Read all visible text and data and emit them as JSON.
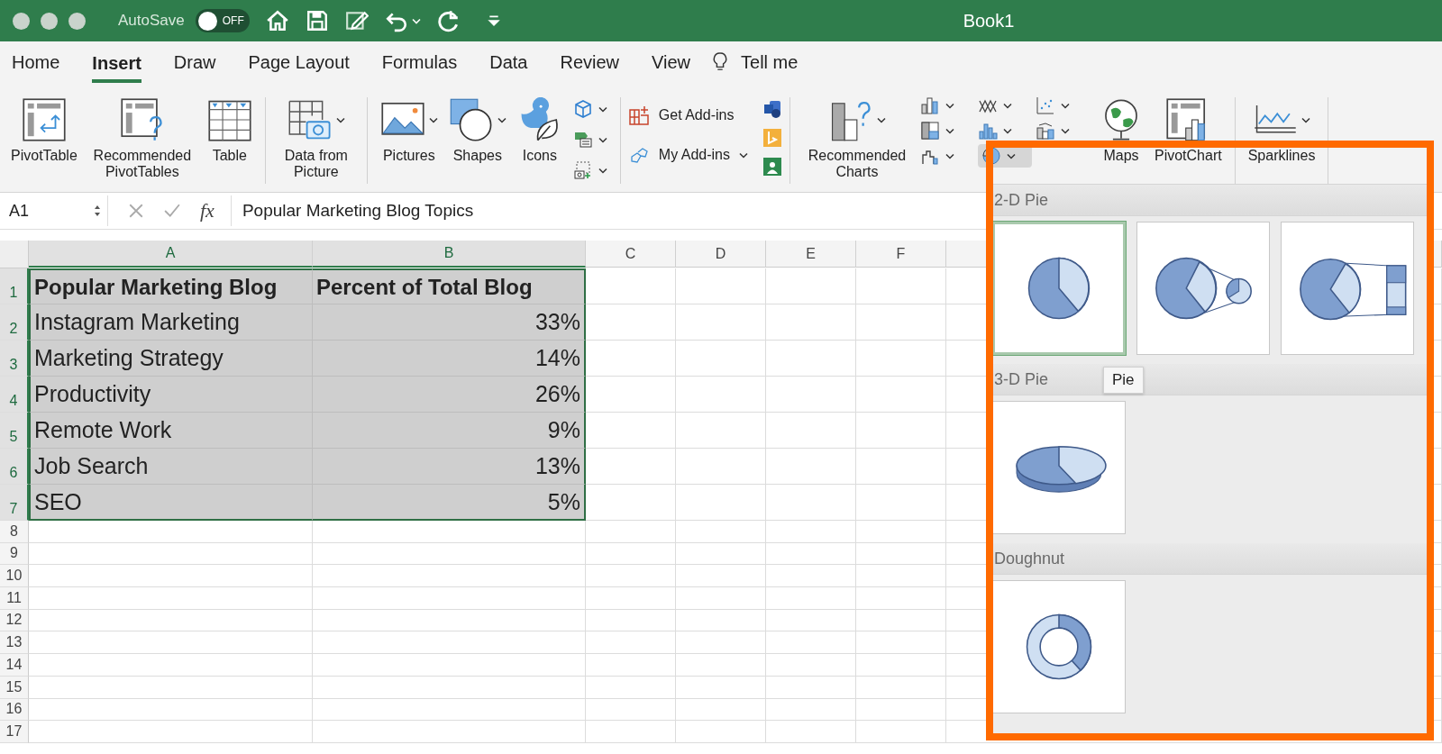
{
  "title_bar": {
    "autosave_label": "AutoSave",
    "autosave": {
      "on": false,
      "label": "OFF"
    },
    "title": "Book1"
  },
  "tabs": [
    {
      "label": "Home",
      "selected": false
    },
    {
      "label": "Insert",
      "selected": true
    },
    {
      "label": "Draw",
      "selected": false
    },
    {
      "label": "Page Layout",
      "selected": false
    },
    {
      "label": "Formulas",
      "selected": false
    },
    {
      "label": "Data",
      "selected": false
    },
    {
      "label": "Review",
      "selected": false
    },
    {
      "label": "View",
      "selected": false
    }
  ],
  "tell_me": "Tell me",
  "ribbon": {
    "pivot_table": "PivotTable",
    "recommended_pivot_tables": "Recommended PivotTables",
    "table": "Table",
    "data_from_picture": "Data from Picture",
    "pictures": "Pictures",
    "shapes": "Shapes",
    "icons": "Icons",
    "get_add_ins": "Get Add-ins",
    "my_add_ins": "My Add-ins",
    "recommended_charts": "Recommended Charts",
    "maps": "Maps",
    "pivot_chart": "PivotChart",
    "sparklines": "Sparklines"
  },
  "formula_bar": {
    "name_box": "A1",
    "fx": "fx",
    "formula": "Popular Marketing Blog Topics"
  },
  "sheet": {
    "columns": [
      {
        "label": "A",
        "selected": true
      },
      {
        "label": "B",
        "selected": true
      },
      {
        "label": "C",
        "selected": false
      },
      {
        "label": "D",
        "selected": false
      },
      {
        "label": "E",
        "selected": false
      },
      {
        "label": "F",
        "selected": false
      }
    ],
    "rows": [
      {
        "number": "1",
        "selected": true,
        "kind": "header",
        "cells": [
          "Popular Marketing Blog",
          "Percent of Total Blog"
        ]
      },
      {
        "number": "2",
        "selected": true,
        "kind": "data",
        "cells": [
          "Instagram Marketing",
          "33%"
        ]
      },
      {
        "number": "3",
        "selected": true,
        "kind": "data",
        "cells": [
          "Marketing Strategy",
          "14%"
        ]
      },
      {
        "number": "4",
        "selected": true,
        "kind": "data",
        "cells": [
          "Productivity",
          "26%"
        ]
      },
      {
        "number": "5",
        "selected": true,
        "kind": "data",
        "cells": [
          "Remote Work",
          "9%"
        ]
      },
      {
        "number": "6",
        "selected": true,
        "kind": "data",
        "cells": [
          "Job Search",
          "13%"
        ]
      },
      {
        "number": "7",
        "selected": true,
        "kind": "data",
        "cells": [
          "SEO",
          "5%"
        ]
      },
      {
        "number": "8",
        "selected": false,
        "kind": "empty"
      },
      {
        "number": "9",
        "selected": false,
        "kind": "empty"
      },
      {
        "number": "10",
        "selected": false,
        "kind": "empty"
      },
      {
        "number": "11",
        "selected": false,
        "kind": "empty"
      },
      {
        "number": "12",
        "selected": false,
        "kind": "empty"
      },
      {
        "number": "13",
        "selected": false,
        "kind": "empty"
      },
      {
        "number": "14",
        "selected": false,
        "kind": "empty"
      },
      {
        "number": "15",
        "selected": false,
        "kind": "empty"
      },
      {
        "number": "16",
        "selected": false,
        "kind": "empty"
      },
      {
        "number": "17",
        "selected": false,
        "kind": "empty"
      }
    ]
  },
  "chart_gallery": {
    "sections": [
      {
        "title": "2-D Pie",
        "thumbnails": [
          {
            "kind": "pie",
            "selected": true
          },
          {
            "kind": "pie-of-pie",
            "selected": false
          },
          {
            "kind": "bar-of-pie",
            "selected": false
          }
        ]
      },
      {
        "title": "3-D Pie",
        "thumbnails": [
          {
            "kind": "pie-3d",
            "selected": false
          }
        ]
      },
      {
        "title": "Doughnut",
        "thumbnails": [
          {
            "kind": "doughnut",
            "selected": false
          }
        ]
      }
    ],
    "tooltip": "Pie"
  }
}
